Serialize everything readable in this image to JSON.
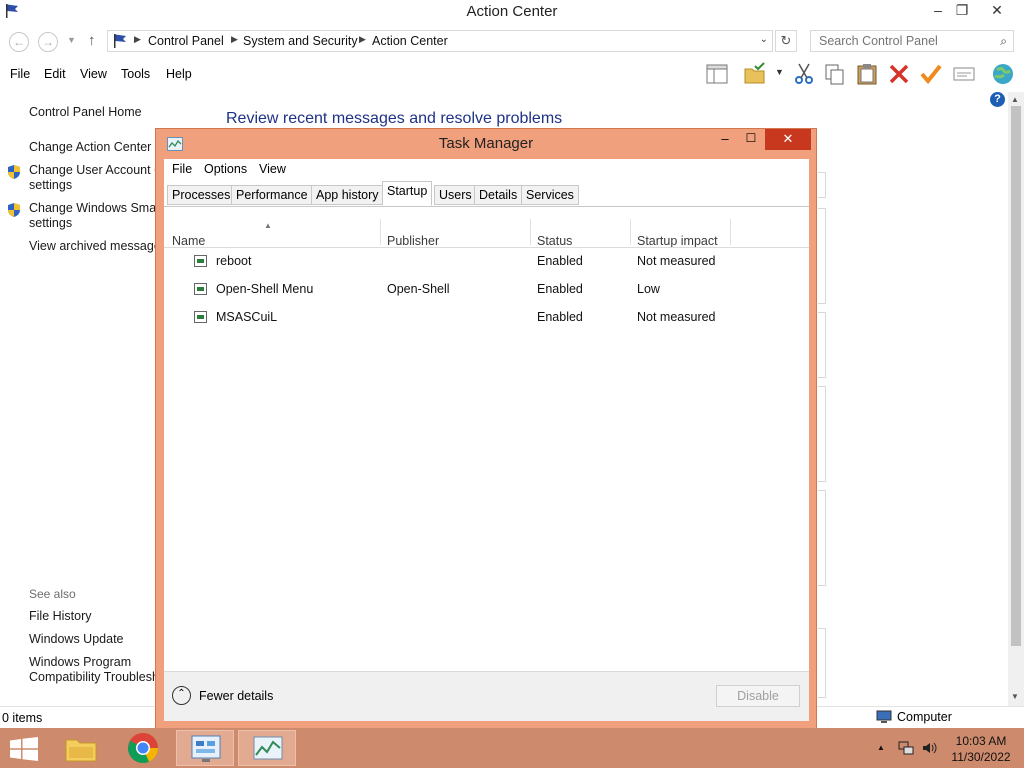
{
  "explorer": {
    "title": "Action Center",
    "menu": [
      "File",
      "Edit",
      "View",
      "Tools",
      "Help"
    ],
    "breadcrumbs": [
      "Control Panel",
      "System and Security",
      "Action Center"
    ],
    "search_placeholder": "Search Control Panel",
    "sidebar": {
      "home": "Control Panel Home",
      "change_action_center": "Change Action Center settings",
      "change_uac_line1": "Change User Account Control",
      "change_uac_line2": "settings",
      "change_smartscreen_line1": "Change Windows SmartScreen",
      "change_smartscreen_line2": "settings",
      "view_archived": "View archived messages",
      "see_also": "See also",
      "file_history": "File History",
      "windows_update": "Windows Update",
      "compat_line1": "Windows Program",
      "compat_line2": "Compatibility Troubleshooter"
    },
    "main_heading": "Review recent messages and resolve problems",
    "status_left": "0 items",
    "status_right": "Computer"
  },
  "taskmgr": {
    "title": "Task Manager",
    "menu": [
      "File",
      "Options",
      "View"
    ],
    "tabs": [
      "Processes",
      "Performance",
      "App history",
      "Startup",
      "Users",
      "Details",
      "Services"
    ],
    "active_tab": "Startup",
    "columns": [
      "Name",
      "Publisher",
      "Status",
      "Startup impact"
    ],
    "rows": [
      {
        "name": "reboot",
        "publisher": "",
        "status": "Enabled",
        "impact": "Not measured"
      },
      {
        "name": "Open-Shell Menu",
        "publisher": "Open-Shell",
        "status": "Enabled",
        "impact": "Low"
      },
      {
        "name": "MSASCuiL",
        "publisher": "",
        "status": "Enabled",
        "impact": "Not measured"
      }
    ],
    "fewer_details": "Fewer details",
    "disable_button": "Disable"
  },
  "taskbar": {
    "time": "10:03 AM",
    "date": "11/30/2022",
    "apps": [
      "file-explorer",
      "chrome",
      "control-panel",
      "task-manager"
    ]
  },
  "colors": {
    "accent_window": "#f0a07c",
    "taskbar": "#cd8a6c",
    "close_red": "#c7381f",
    "link_blue": "#1e3287"
  }
}
